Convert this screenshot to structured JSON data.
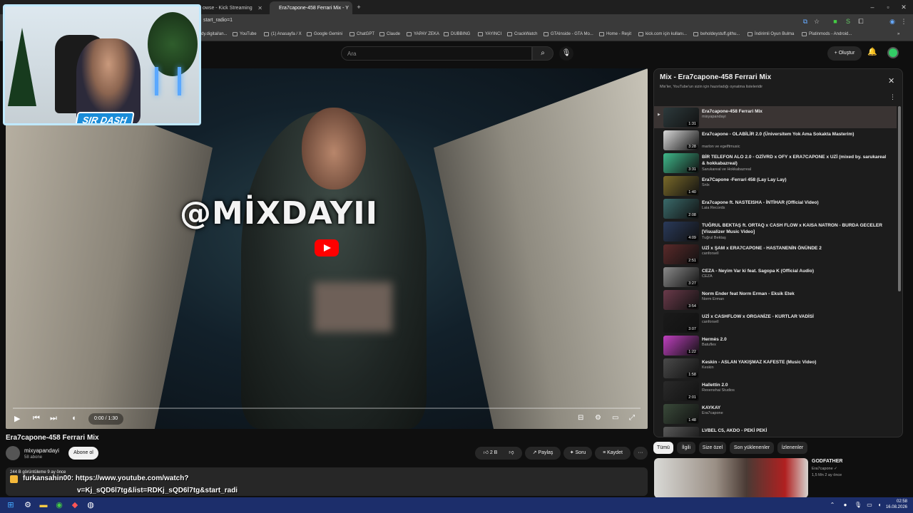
{
  "browser": {
    "tabs": [
      {
        "label": "owse - Kick Streaming",
        "active": false
      },
      {
        "label": "Era7capone-458 Ferrari Mix - Y",
        "active": true
      }
    ],
    "new_tab": "+",
    "url": "start_radio=1",
    "bookmarks": [
      "dy.digital/an...",
      "YouTube",
      "(1) Anasayfa / X",
      "Google Gemini",
      "ChatGPT",
      "Claude",
      "YAPAY ZEKA",
      "DUBBING",
      "YAYINCI",
      "CrackWatch",
      "GTAInside - GTA Mo...",
      "Home - Reşit",
      "kick.com için kullanı...",
      "beholdeystuff.githu...",
      "İndirimli Oyun Bulma",
      "Platinmods - Android..."
    ]
  },
  "youtube": {
    "search_placeholder": "Ara",
    "create_label": "+ Oluştur"
  },
  "player": {
    "overlay_text": "@MİXDAYII",
    "time": "0:00 / 1:30",
    "progress": 0
  },
  "webcam": {
    "logo": "SIR DASH"
  },
  "video": {
    "title": "Era7capone-458 Ferrari Mix",
    "channel": "mixyapandayi",
    "subs": "58 abone",
    "subscribe": "Abone ol",
    "likes": "2 B",
    "share": "Paylaş",
    "ask": "Soru",
    "save": "Kaydet",
    "more": "···",
    "views": "244 B görüntüleme  9 ay önce"
  },
  "chat": {
    "user": "furkansahin00:",
    "line1": "https://www.youtube.com/watch?",
    "line2": "v=Kj_sQD6l7tg&list=RDKj_sQD6l7tg&start_radi"
  },
  "playlist": {
    "title": "Mix - Era7capone-458 Ferrari Mix",
    "subtitle": "Mix'ler, YouTube'un sizin için hazırladığı oynatma listeleridir",
    "items": [
      {
        "title": "Era7capone-458 Ferrari Mix",
        "channel": "mixyapandayi",
        "duration": "1:31",
        "active": true,
        "color": "#2d3a3c"
      },
      {
        "title": "Era7capone - OLABİLİR 2.0 (Üniversitem Yok Ama Sokakta Masterim)",
        "channel": "marlon ve egelftmusic",
        "duration": "3:28",
        "active": false,
        "color": "#d8d8d8"
      },
      {
        "title": "BİR TELEFON ALO 2.0 - OZİVRD x OFY x ERA7CAPONE x UZİ (mixed by. sarukareal & hokkabazreal)",
        "channel": "Sarukareal ve Hokkabazreal",
        "duration": "3:31",
        "active": false,
        "color": "#3fb88a"
      },
      {
        "title": "Era7Capone -Ferrari 458 (Lay Lay Lay)",
        "channel": "Snlx",
        "duration": "1:40",
        "active": false,
        "color": "#7a6a2a"
      },
      {
        "title": "Era7capone ft. NASTEISHA - İNTİHAR (Official Video)",
        "channel": "Laia Records",
        "duration": "2:08",
        "active": false,
        "color": "#3a6a6a"
      },
      {
        "title": "TUĞRUL BEKTAŞ ft. ORTAQ x CASH FLOW x KAISA NATRON - BURDA GECELER [Visualizer Music Video]",
        "channel": "Tuğrul Bektaş",
        "duration": "4:09",
        "active": false,
        "color": "#2a3a5a"
      },
      {
        "title": "UZİ x ŞAM x ERA7CAPONE - HASTANENİN ÖNÜNDE 2",
        "channel": "canforsell",
        "duration": "2:51",
        "active": false,
        "color": "#5a2a2a"
      },
      {
        "title": "CEZA - Neyim Var ki feat. Sagopa K (Official Audio)",
        "channel": "CEZA",
        "duration": "3:27",
        "active": false,
        "color": "#8a8a8a"
      },
      {
        "title": "Norm Ender feat Norm Erman - Eksik Etek",
        "channel": "Norm Erman",
        "duration": "3:54",
        "active": false,
        "color": "#6a3a4a"
      },
      {
        "title": "UZİ x CASHFLOW x ORGANİZE - KURTLAR VADİSİ",
        "channel": "canforsell",
        "duration": "3:07",
        "active": false,
        "color": "#1a1a1a"
      },
      {
        "title": "Hermès 2.0",
        "channel": "Batuflex",
        "duration": "1:22",
        "active": false,
        "color": "#c040c0"
      },
      {
        "title": "Keskin - ASLAN YAKIŞMAZ KAFESTE (Music Video)",
        "channel": "Keskin",
        "duration": "1:58",
        "active": false,
        "color": "#4a4a4a"
      },
      {
        "title": "Hallettin 2.0",
        "channel": "Rexenshai Studios",
        "duration": "2:01",
        "active": false,
        "color": "#2a2a2a"
      },
      {
        "title": "KAYKAY",
        "channel": "Era7capone",
        "duration": "1:48",
        "active": false,
        "color": "#3a4a3a"
      },
      {
        "title": "LVBEL C5, AKDO - PEKİ PEKİ",
        "channel": "",
        "duration": "",
        "active": false,
        "color": "#5a5a5a"
      }
    ]
  },
  "chips": [
    "Tümü",
    "İlgili",
    "Size özel",
    "Son yüklenenler",
    "İzlenenler"
  ],
  "recommendation": {
    "title": "GODFATHER",
    "channel": "Era7capone",
    "meta": "1,5 Mn  2 ay önce"
  },
  "clock": {
    "time": "02:58",
    "date": "16.08.2026"
  }
}
